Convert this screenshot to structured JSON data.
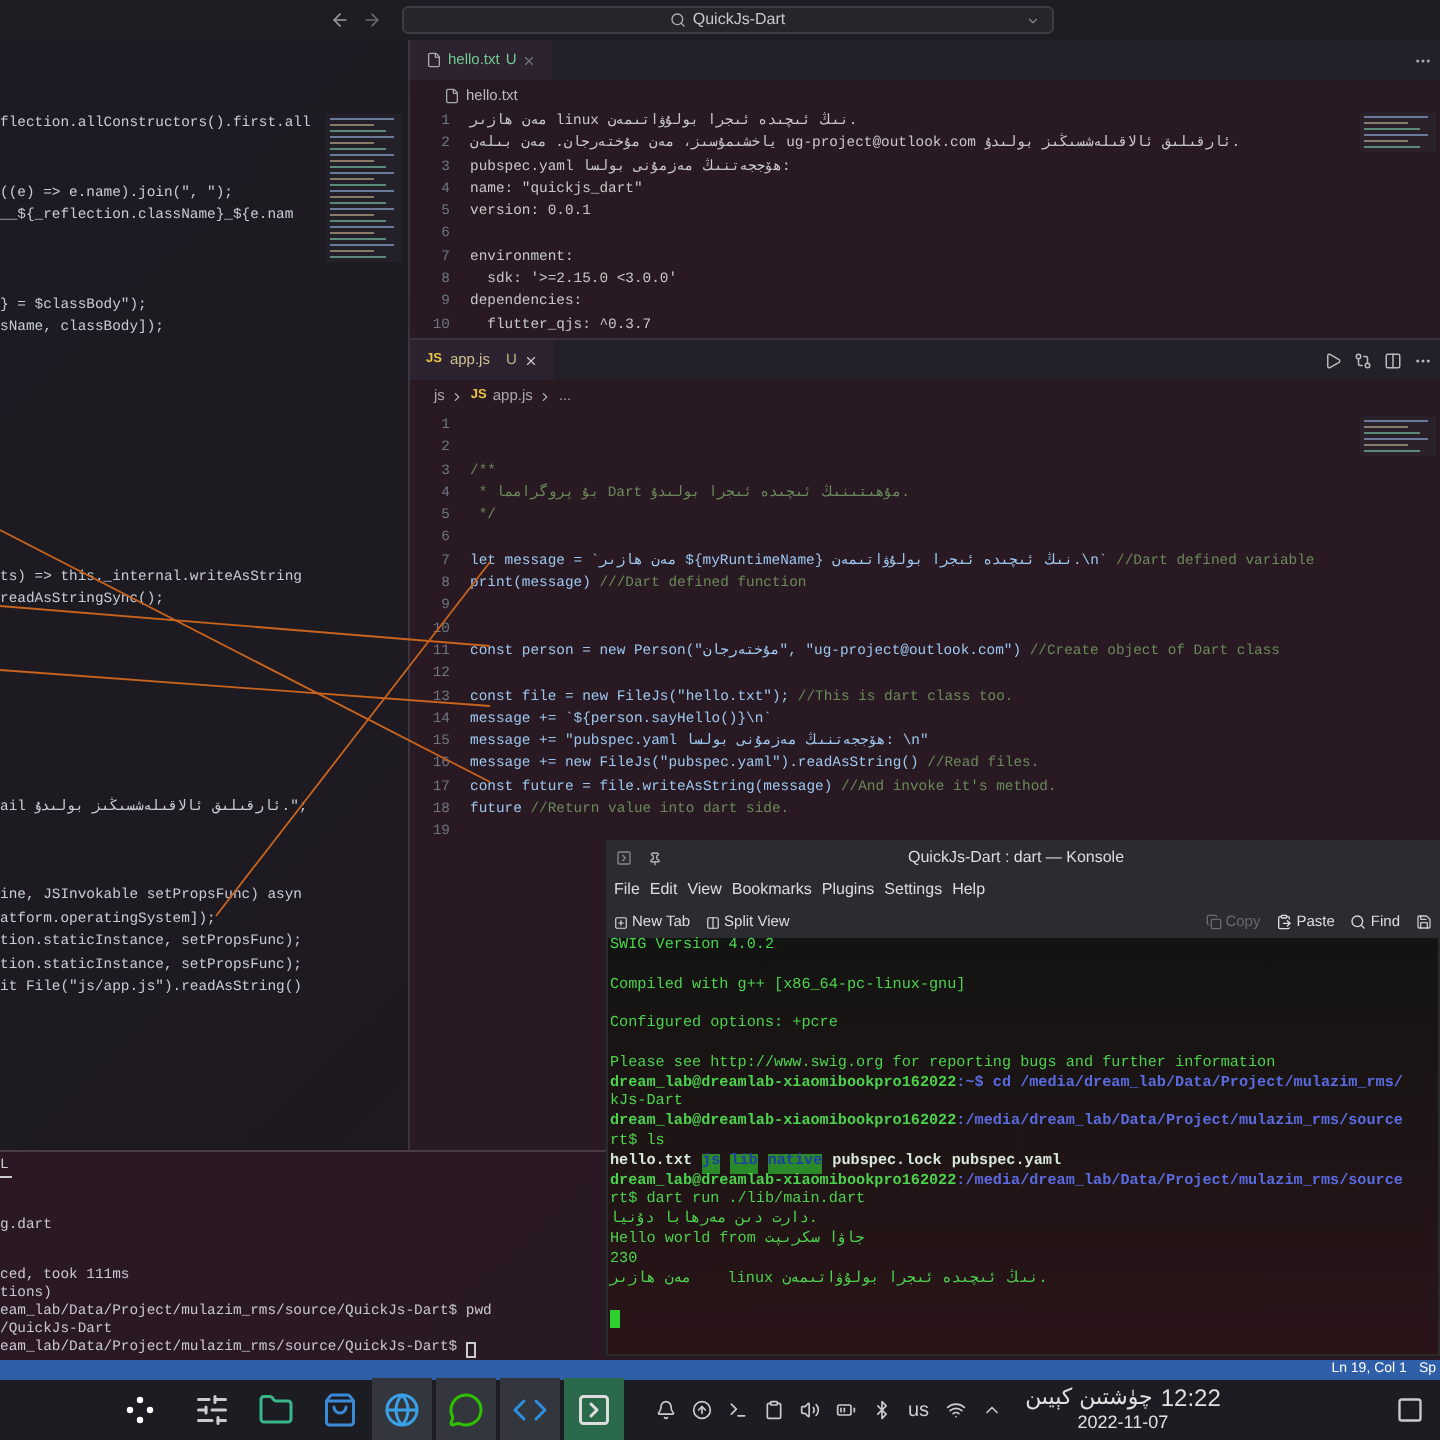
{
  "title_bar": {
    "search": "QuickJs-Dart"
  },
  "left_editor": {
    "lines": [
      "flection.allConstructors().first.all",
      "((e) => e.name).join(\", \");",
      "__${_reflection.className}_${e.nam",
      "} = $classBody\");",
      "sName, classBody]);",
      "ts) => this._internal.writeAsString",
      "readAsStringSync();",
      "ail ئارقىلىق ئالاقىلەشسىڭىز بولىدۇ.\";",
      "ine, JSInvokable setPropsFunc) asyn",
      "atform.operatingSystem]);",
      "tion.staticInstance, setPropsFunc);",
      "tion.staticInstance, setPropsFunc);",
      "it File(\"js/app.js\").readAsString()"
    ]
  },
  "hello_editor": {
    "tab": {
      "label": "hello.txt",
      "status": "U"
    },
    "breadcrumb": "hello.txt",
    "lines": [
      {
        "n": "1",
        "text": "مەن هازىر linux نىڭ ئىچىدە ئىجرا بولۇۋاتىمەن."
      },
      {
        "n": "2",
        "text": "ياخشىمۇسىز، مەن مۇختەرجان. مەن بىلەن ug-project@outlook.com ئارقىلىق ئالاقىلەشسىڭىز بولىدۇ."
      },
      {
        "n": "3",
        "text": "pubspec.yaml ھۆججەتنىڭ مەزمۇنى بولسا:"
      },
      {
        "n": "4",
        "text": "name: \"quickjs_dart\""
      },
      {
        "n": "5",
        "text": "version: 0.0.1"
      },
      {
        "n": "6"
      },
      {
        "n": "7",
        "text": "environment:"
      },
      {
        "n": "8",
        "text": "  sdk: '>=2.15.0 <3.0.0'"
      },
      {
        "n": "9",
        "text": "dependencies:"
      },
      {
        "n": "10",
        "text": "  flutter_qjs: ^0.3.7"
      }
    ]
  },
  "app_editor": {
    "tab": {
      "badge": "JS",
      "label": "app.js",
      "status": "U"
    },
    "breadcrumb": [
      {
        "kind": "folder",
        "text": "js"
      },
      {
        "kind": "file",
        "badge": "JS",
        "text": "app.js"
      },
      {
        "kind": "folder",
        "text": "..."
      }
    ],
    "lines": [
      {
        "n": "1"
      },
      {
        "n": "2"
      },
      {
        "n": "3",
        "comment": "/**"
      },
      {
        "n": "4",
        "comment": " * بۇ پروگرامما Dart مۇھىتىنىڭ ئىچىدە ئىجرا بولىدۇ."
      },
      {
        "n": "5",
        "comment": " */"
      },
      {
        "n": "6"
      },
      {
        "n": "7",
        "code": "let message = `مەن هازىر ${myRuntimeName} نىڭ ئىچىدە ئىجرا بولۇۋاتىمەن.\\n`",
        "comment": " //Dart defined variable"
      },
      {
        "n": "8",
        "code": "print(message)",
        "comment": " ///Dart defined function"
      },
      {
        "n": "9"
      },
      {
        "n": "10"
      },
      {
        "n": "11",
        "code": "const person = new Person(\"مۇختەرجان\", \"ug-project@outlook.com\")",
        "comment": " //Create object of Dart class"
      },
      {
        "n": "12"
      },
      {
        "n": "13",
        "code": "const file = new FileJs(\"hello.txt\");",
        "comment": " //This is dart class too."
      },
      {
        "n": "14",
        "code": "message += `${person.sayHello()}\\n`"
      },
      {
        "n": "15",
        "code": "message += \"pubspec.yaml ھۆججەتنىڭ مەزمۇنى بولسا: \\n\""
      },
      {
        "n": "16",
        "code": "message += new FileJs(\"pubspec.yaml\").readAsString()",
        "comment": " //Read files."
      },
      {
        "n": "17",
        "code": "const future = file.writeAsString(message)",
        "comment": " //And invoke it's method."
      },
      {
        "n": "18",
        "code": "future",
        "comment": " //Return value into dart side."
      },
      {
        "n": "19"
      }
    ]
  },
  "panel": {
    "tab": "L",
    "lines": [
      "g.dart",
      "ced, took 111ms",
      "tions)",
      "eam_lab/Data/Project/mulazim_rms/source/QuickJs-Dart$ pwd",
      "/QuickJs-Dart",
      "eam_lab/Data/Project/mulazim_rms/source/QuickJs-Dart$"
    ]
  },
  "status_bar": {
    "position": "Ln 19, Col 1",
    "extra": "Sp"
  },
  "konsole": {
    "title": "QuickJs-Dart : dart — Konsole",
    "menu": [
      "File",
      "Edit",
      "View",
      "Bookmarks",
      "Plugins",
      "Settings",
      "Help"
    ],
    "toolbar_left": [
      "New Tab",
      "Split View"
    ],
    "toolbar_right": [
      {
        "kind": "copy",
        "label": "Copy",
        "disabled": true
      },
      {
        "kind": "paste",
        "label": "Paste",
        "disabled": false
      },
      {
        "kind": "find",
        "label": "Find",
        "disabled": false
      }
    ],
    "lines": [
      {
        "kind": "output",
        "text": "SWIG Version 4.0.2"
      },
      {
        "kind": "blank"
      },
      {
        "kind": "output",
        "text": "Compiled with g++ [x86_64-pc-linux-gnu]"
      },
      {
        "kind": "blank"
      },
      {
        "kind": "output",
        "text": "Configured options: +pcre"
      },
      {
        "kind": "blank"
      },
      {
        "kind": "output",
        "text": "Please see http://www.swig.org for reporting bugs and further information"
      },
      {
        "kind": "prompt",
        "user": "dream_lab@dreamlab-xiaomibookpro162022",
        "path": ":~$ cd /media/dream_lab/Data/Project/mulazim_rms/"
      },
      {
        "kind": "output",
        "text": "kJs-Dart"
      },
      {
        "kind": "prompt",
        "user": "dream_lab@dreamlab-xiaomibookpro162022",
        "path": ":/media/dream_lab/Data/Project/mulazim_rms/source"
      },
      {
        "kind": "output",
        "text": "rt$ ls"
      },
      {
        "kind": "ls",
        "items": [
          {
            "text": "hello.txt",
            "highlight": false
          },
          {
            "text": "js",
            "highlight": true
          },
          {
            "text": "lib",
            "highlight": true
          },
          {
            "text": "native",
            "highlight": true
          },
          {
            "text": "pubspec.lock",
            "highlight": false
          },
          {
            "text": "pubspec.yaml",
            "highlight": false
          }
        ]
      },
      {
        "kind": "prompt",
        "user": "dream_lab@dreamlab-xiaomibookpro162022",
        "path": ":/media/dream_lab/Data/Project/mulazim_rms/source"
      },
      {
        "kind": "output",
        "text": "rt$ dart run ./lib/main.dart"
      },
      {
        "kind": "output",
        "text": "دارت دىن مەرھابا دۇنيا."
      },
      {
        "kind": "output",
        "text": "Hello world from جاۋا سكرىپت"
      },
      {
        "kind": "output",
        "text": "230"
      },
      {
        "kind": "output",
        "text": "مەن هازىر    linux نىڭ ئىچىدە ئىجرا بولۇۋاتىمەن."
      },
      {
        "kind": "blank"
      },
      {
        "kind": "cursor"
      }
    ]
  },
  "taskbar": {
    "keyboard": "us",
    "time": "12:22",
    "period": "چۈشتىن كېيىن",
    "date": "2022-11-07"
  }
}
